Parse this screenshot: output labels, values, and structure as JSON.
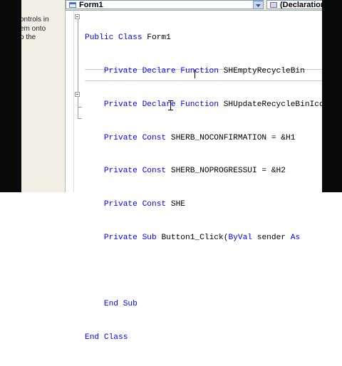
{
  "toolbox": {
    "lines": [
      "ontrols in",
      "em onto",
      "o the"
    ]
  },
  "header": {
    "object_combo": "Form1",
    "procedure_combo": "(Declarations)"
  },
  "code": {
    "line1": {
      "kw": "Public Class ",
      "rest": "Form1"
    },
    "line2": {
      "indent": "    ",
      "kw": "Private Declare Function ",
      "rest": "SHEmptyRecycleBin"
    },
    "line3": {
      "indent": "    ",
      "kw": "Private Declare Function ",
      "rest": "SHUpdateRecycleBinIcon"
    },
    "line4": {
      "indent": "    ",
      "kw": "Private Const ",
      "rest": "SHERB_NOCONFIRMATION = &H1"
    },
    "line5": {
      "indent": "    ",
      "kw": "Private Const ",
      "rest": "SHERB_NOPROGRESSUI = &H2"
    },
    "line6": {
      "indent": "    ",
      "kw": "Private Const ",
      "rest": "SHE"
    },
    "line7": {
      "indent": "    ",
      "kw": "Private Sub ",
      "rest": "Button1_Click(",
      "kw2": "ByVal ",
      "rest2": "sender ",
      "kw3": "As"
    },
    "line8": {
      "text": ""
    },
    "line9": {
      "indent": "    ",
      "kw": "End Sub"
    },
    "line10": {
      "kw": "End Class"
    }
  },
  "icons": {
    "form_icon": "form-icon",
    "declarations_icon": "declarations-icon",
    "dropdown_icon": "chevron-down-icon",
    "cursor_icon": "ibeam-cursor-icon"
  }
}
